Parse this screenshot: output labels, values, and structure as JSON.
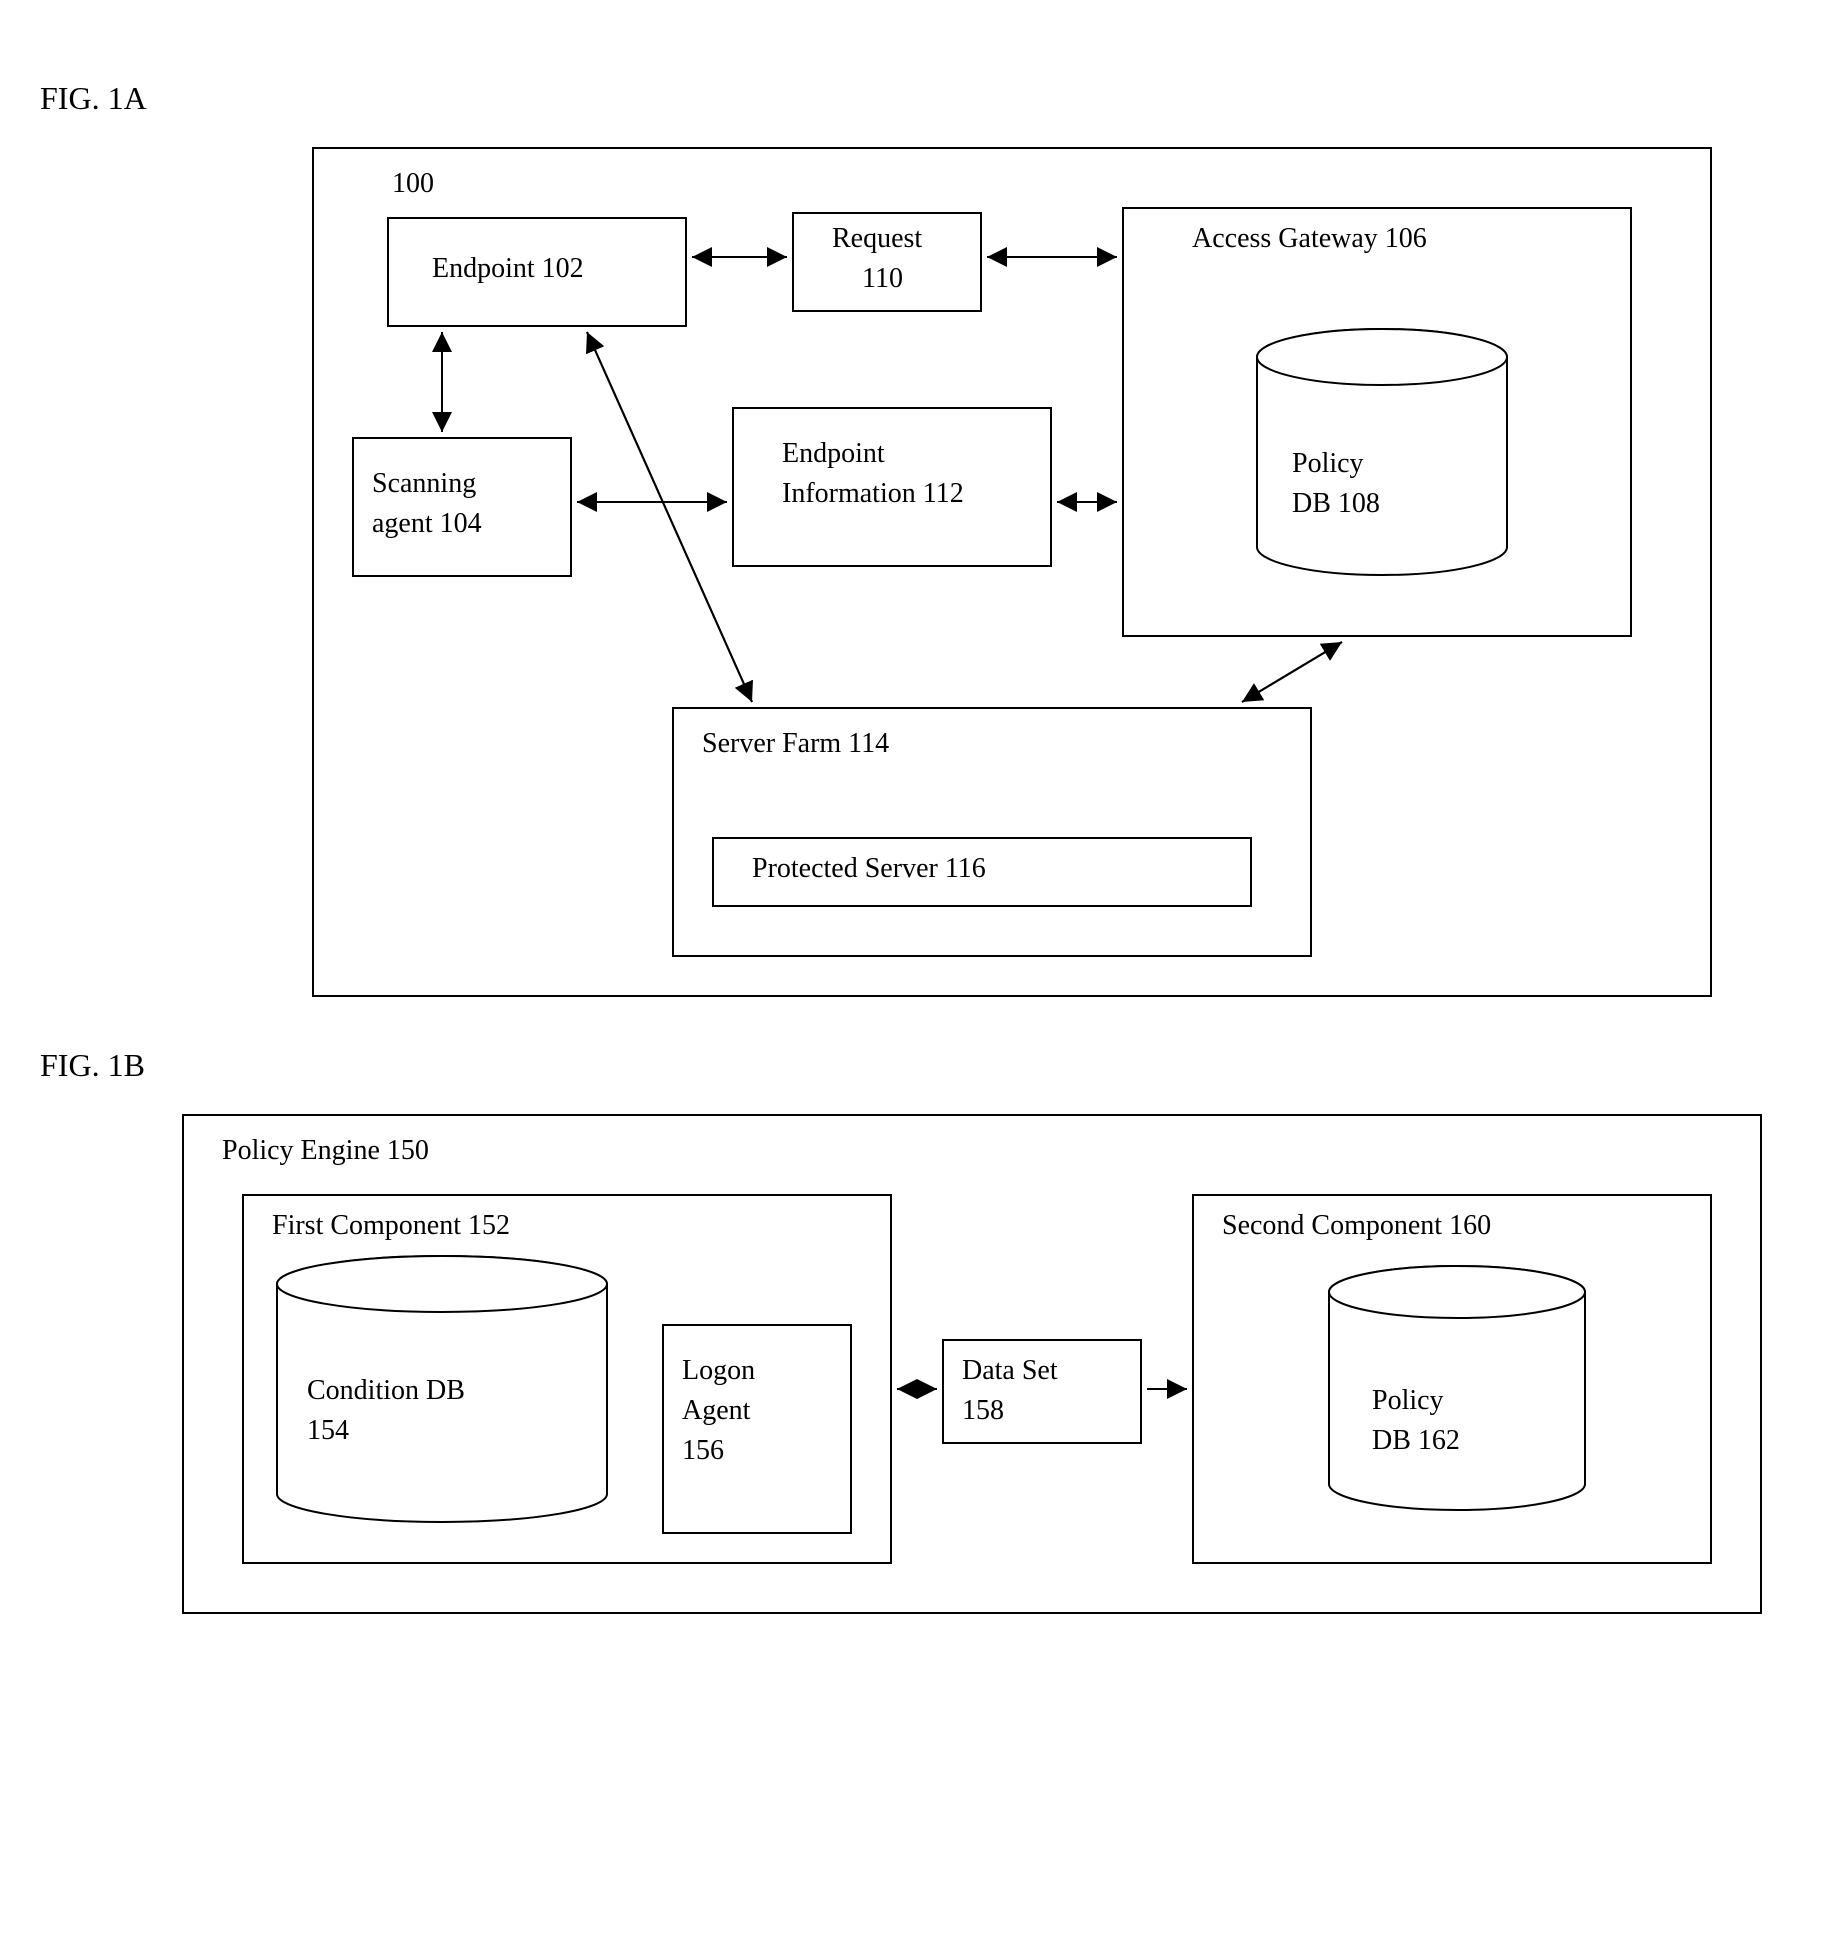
{
  "fig1a": {
    "title": "FIG. 1A",
    "system_id": "100",
    "endpoint": "Endpoint 102",
    "scanning_agent_l1": "Scanning",
    "scanning_agent_l2": "agent 104",
    "request_l1": "Request",
    "request_l2": "110",
    "endpoint_info_l1": "Endpoint",
    "endpoint_info_l2": "Information 112",
    "access_gateway": "Access Gateway 106",
    "policy_db_l1": "Policy",
    "policy_db_l2": "DB 108",
    "server_farm": "Server Farm 114",
    "protected_server": "Protected Server 116"
  },
  "fig1b": {
    "title": "FIG. 1B",
    "policy_engine": "Policy Engine 150",
    "first_component": "First Component 152",
    "condition_db_l1": "Condition DB",
    "condition_db_l2": "154",
    "logon_agent_l1": "Logon",
    "logon_agent_l2": "Agent",
    "logon_agent_l3": "156",
    "data_set_l1": "Data Set",
    "data_set_l2": "158",
    "second_component": "Second Component 160",
    "policy_db2_l1": "Policy",
    "policy_db2_l2": "DB 162"
  }
}
